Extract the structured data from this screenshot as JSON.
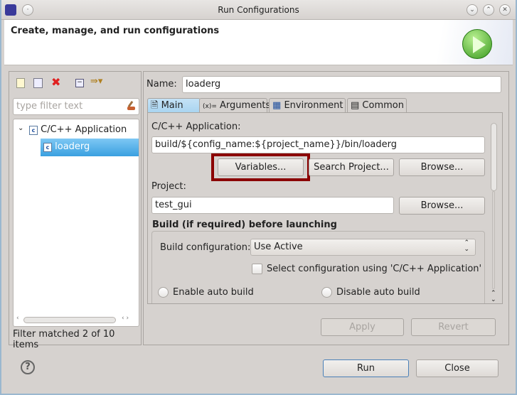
{
  "window": {
    "title": "Run Configurations"
  },
  "banner": {
    "heading": "Create, manage, and run configurations"
  },
  "left": {
    "filter_placeholder": "type filter text",
    "tree": [
      {
        "label": "C/C++ Application",
        "expanded": true,
        "children": [
          {
            "label": "loaderg",
            "selected": true
          }
        ]
      }
    ],
    "status": "Filter matched 2 of 10 items"
  },
  "right": {
    "name_label": "Name:",
    "name_value": "loaderg",
    "tabs": [
      {
        "label": "Main",
        "active": true
      },
      {
        "label": "Arguments"
      },
      {
        "label": "Environment"
      },
      {
        "label": "Common"
      }
    ],
    "app_label": "C/C++ Application:",
    "app_value": "build/${config_name:${project_name}}/bin/loaderg",
    "variables_btn": "Variables...",
    "search_project_btn": "Search Project...",
    "browse_btn": "Browse...",
    "project_label": "Project:",
    "project_value": "test_gui",
    "browse2_btn": "Browse...",
    "build_heading": "Build (if required) before launching",
    "build_config_label": "Build configuration:",
    "build_config_value": "Use Active",
    "select_config_checkbox": "Select configuration using 'C/C++ Application'",
    "select_config_checked": false,
    "enable_auto": "Enable auto build",
    "disable_auto": "Disable auto build",
    "apply_btn": "Apply",
    "revert_btn": "Revert"
  },
  "footer": {
    "run_btn": "Run",
    "close_btn": "Close"
  },
  "colors": {
    "highlight_box": "#8b0000",
    "selection": "#4aa6e0"
  }
}
